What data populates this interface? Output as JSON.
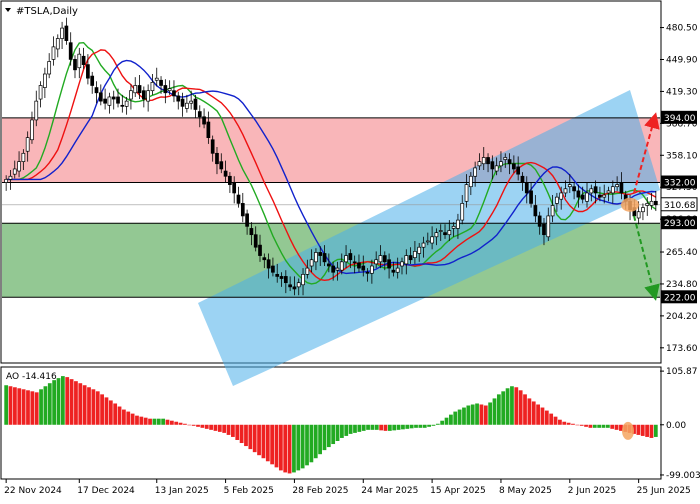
{
  "chart_data": {
    "type": "candlestick",
    "title": "#TSLA,Daily",
    "price_ticks": [
      "480.50",
      "449.90",
      "419.30",
      "388.70",
      "358.10",
      "327.50",
      "296.90",
      "265.40",
      "234.80",
      "204.20",
      "173.60"
    ],
    "price_tick_values": [
      480.5,
      449.9,
      419.3,
      388.7,
      358.1,
      327.5,
      296.9,
      265.4,
      234.8,
      204.2,
      173.6
    ],
    "price_range": [
      160,
      505
    ],
    "last_price": "310.68",
    "last_price_value": 310.68,
    "levels": [
      {
        "label": "394.00",
        "value": 394.0
      },
      {
        "label": "332.00",
        "value": 332.0
      },
      {
        "label": "293.00",
        "value": 293.0
      },
      {
        "label": "222.00",
        "value": 222.0
      }
    ],
    "zones": [
      {
        "name": "resistance",
        "from": 332.0,
        "to": 394.0,
        "color": "#f47a7f"
      },
      {
        "name": "support",
        "from": 222.0,
        "to": 293.0,
        "color": "#3a9a3a"
      }
    ],
    "channel": {
      "color": "#4aaeea",
      "lower_start_price": 190,
      "lower_end_price": 320,
      "width_price": 118
    },
    "forecast": {
      "up_target": 394.0,
      "down_target": 222.0,
      "up_color": "#ee2222",
      "down_color": "#229922"
    },
    "date_labels": [
      "22 Nov 2024",
      "17 Dec 2024",
      "13 Jan 2025",
      "5 Feb 2025",
      "28 Feb 2025",
      "24 Mar 2025",
      "15 Apr 2025",
      "8 May 2025",
      "2 Jun 2025",
      "25 Jun 2025"
    ],
    "date_label_index": [
      0,
      17,
      35,
      51,
      67,
      83,
      99,
      115,
      131,
      147
    ],
    "closes": [
      335,
      338,
      345,
      352,
      360,
      375,
      392,
      410,
      425,
      436,
      448,
      462,
      470,
      480,
      468,
      450,
      440,
      455,
      445,
      432,
      425,
      418,
      410,
      408,
      414,
      412,
      408,
      405,
      410,
      420,
      425,
      418,
      412,
      420,
      428,
      432,
      425,
      418,
      422,
      415,
      410,
      405,
      408,
      410,
      402,
      395,
      388,
      375,
      360,
      350,
      345,
      338,
      330,
      322,
      312,
      300,
      290,
      282,
      270,
      262,
      258,
      250,
      246,
      242,
      240,
      236,
      232,
      230,
      236,
      244,
      250,
      258,
      265,
      262,
      256,
      252,
      246,
      250,
      256,
      262,
      258,
      255,
      250,
      248,
      245,
      252,
      258,
      262,
      256,
      250,
      246,
      250,
      256,
      262,
      258,
      266,
      270,
      274,
      276,
      280,
      284,
      286,
      282,
      286,
      290,
      296,
      312,
      330,
      338,
      346,
      352,
      356,
      350,
      345,
      348,
      352,
      356,
      350,
      345,
      340,
      332,
      322,
      312,
      300,
      290,
      282,
      300,
      310,
      318,
      322,
      326,
      330,
      324,
      318,
      316,
      322,
      326,
      322,
      318,
      320,
      324,
      328,
      330,
      322,
      314,
      306,
      300,
      304,
      308,
      312,
      314,
      310.68
    ],
    "ao_values": [
      78,
      76,
      74,
      72,
      70,
      68,
      66,
      64,
      70,
      76,
      82,
      88,
      92,
      96,
      94,
      90,
      86,
      82,
      78,
      74,
      70,
      66,
      60,
      54,
      48,
      42,
      36,
      30,
      26,
      22,
      18,
      16,
      14,
      12,
      12,
      12,
      12,
      10,
      8,
      6,
      4,
      2,
      0,
      -2,
      -4,
      -6,
      -8,
      -10,
      -12,
      -14,
      -16,
      -20,
      -24,
      -30,
      -36,
      -42,
      -48,
      -54,
      -60,
      -66,
      -72,
      -78,
      -84,
      -90,
      -94,
      -96,
      -94,
      -90,
      -86,
      -80,
      -74,
      -66,
      -58,
      -50,
      -44,
      -38,
      -32,
      -26,
      -22,
      -18,
      -16,
      -14,
      -12,
      -10,
      -10,
      -10,
      -11,
      -12,
      -12,
      -11,
      -10,
      -9,
      -8,
      -7,
      -6,
      -6,
      -6,
      -4,
      -2,
      2,
      8,
      14,
      20,
      26,
      30,
      34,
      38,
      40,
      42,
      40,
      38,
      44,
      52,
      60,
      66,
      72,
      76,
      74,
      68,
      60,
      52,
      46,
      40,
      34,
      28,
      22,
      16,
      10,
      6,
      4,
      2,
      0,
      -2,
      -4,
      -6,
      -6,
      -6,
      -6,
      -6,
      -8,
      -10,
      -12,
      -14,
      -16,
      -18,
      -20,
      -22,
      -24,
      -26,
      -24
    ],
    "ao_label": "AO -14.416",
    "ao_ticks": [
      "105.87",
      "0.00",
      "-99.003"
    ],
    "ao_tick_values": [
      105.87,
      0.0,
      -99.003
    ],
    "ao_range": [
      -105,
      112
    ],
    "ao_up_color": "#22aa22",
    "ao_down_color": "#ee2222"
  }
}
